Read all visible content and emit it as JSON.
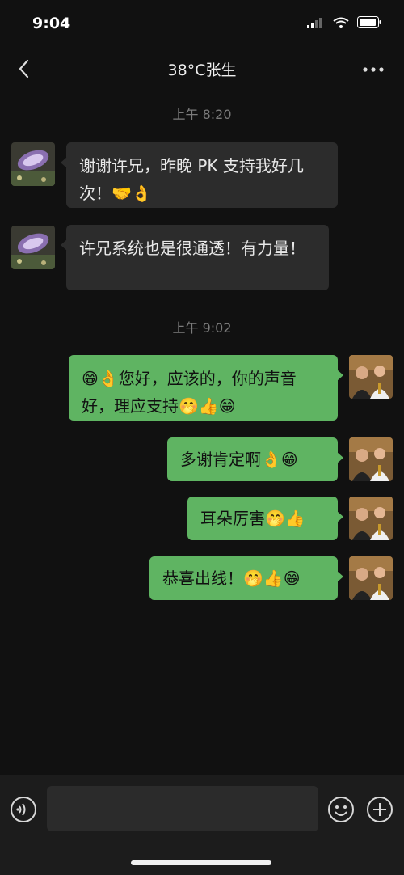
{
  "status_bar": {
    "time": "9:04"
  },
  "header": {
    "title": "38°C张生"
  },
  "messages": [
    {
      "type": "time",
      "text": "上午 8:20"
    },
    {
      "type": "incoming",
      "text": "谢谢许兄，昨晚 PK 支持我好几次！🤝👌"
    },
    {
      "type": "incoming",
      "text": "许兄系统也是很通透！有力量！"
    },
    {
      "type": "time",
      "text": "上午 9:02"
    },
    {
      "type": "outgoing",
      "text": "😁👌您好，应该的，你的声音好，理应支持🤭👍😁"
    },
    {
      "type": "outgoing",
      "text": "多谢肯定啊👌😁"
    },
    {
      "type": "outgoing",
      "text": "耳朵厉害🤭👍"
    },
    {
      "type": "outgoing",
      "text": "恭喜出线！🤭👍😁"
    }
  ],
  "colors": {
    "background": "#111111",
    "incoming_bubble": "#2c2c2c",
    "outgoing_bubble": "#5fb462",
    "input_bar": "#1c1c1c"
  },
  "icons": {
    "back": "chevron-left-icon",
    "more": "more-horizontal-icon",
    "voice": "voice-icon",
    "emoji": "emoji-icon",
    "plus": "plus-icon"
  }
}
